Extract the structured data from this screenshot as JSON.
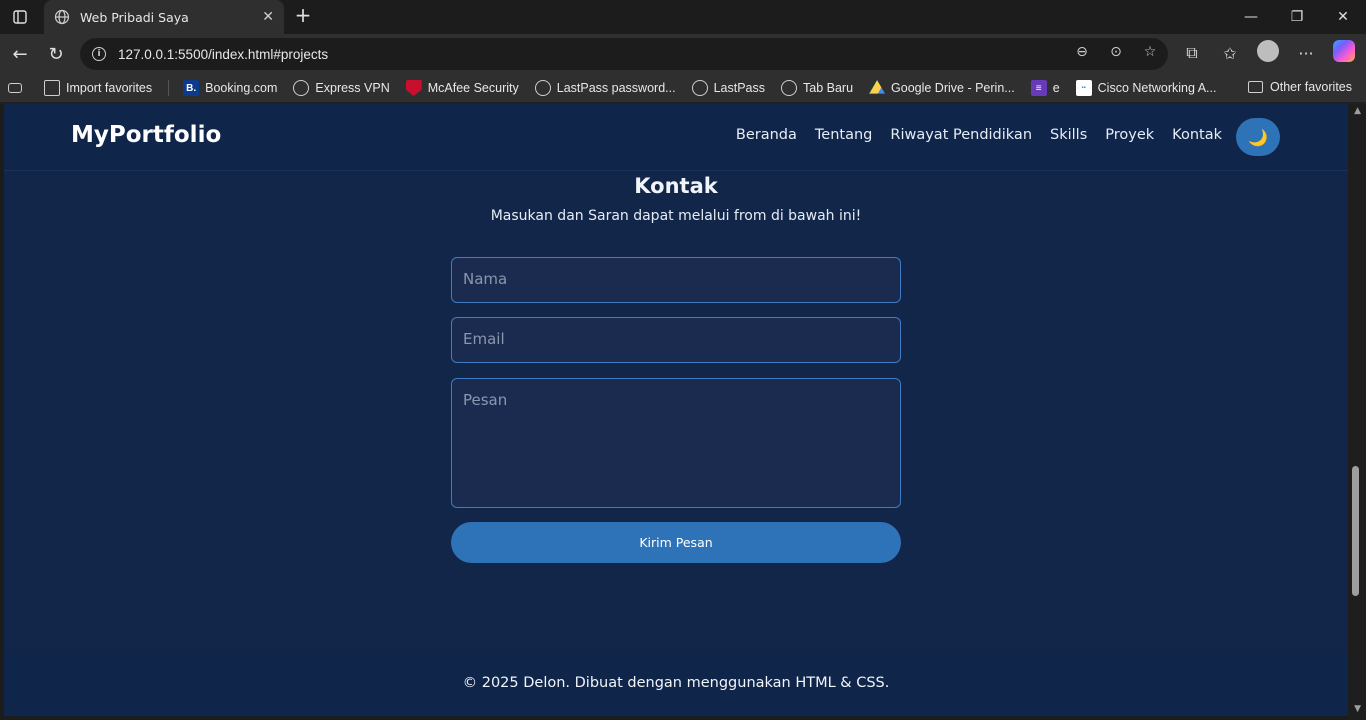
{
  "browser": {
    "tab_title": "Web Pribadi Saya",
    "url": "127.0.0.1:5500/index.html#projects",
    "favorites": [
      {
        "label": "Import favorites",
        "icon": "import-icon"
      },
      {
        "label": "Booking.com",
        "icon": "booking-icon"
      },
      {
        "label": "Express VPN",
        "icon": "globe-icon"
      },
      {
        "label": "McAfee Security",
        "icon": "mcafee-icon"
      },
      {
        "label": "LastPass password...",
        "icon": "globe-icon"
      },
      {
        "label": "LastPass",
        "icon": "globe-icon"
      },
      {
        "label": "Tab Baru",
        "icon": "globe-icon"
      },
      {
        "label": "Google Drive - Perin...",
        "icon": "google-drive-icon"
      },
      {
        "label": "e",
        "icon": "forms-icon"
      },
      {
        "label": "Cisco Networking A...",
        "icon": "cisco-icon"
      }
    ],
    "other_favorites": "Other favorites"
  },
  "site": {
    "logo": "MyPortfolio",
    "menu": [
      "Beranda",
      "Tentang",
      "Riwayat Pendidikan",
      "Skills",
      "Proyek",
      "Kontak"
    ],
    "theme_toggle_icon": "🌙"
  },
  "contact": {
    "title": "Kontak",
    "subtitle": "Masukan dan Saran dapat melalui from di bawah ini!",
    "name_placeholder": "Nama",
    "email_placeholder": "Email",
    "message_placeholder": "Pesan",
    "submit_label": "Kirim Pesan"
  },
  "footer": {
    "text": "© 2025 Delon. Dibuat dengan menggunakan HTML & CSS."
  },
  "colors": {
    "page_bg": "#12264a",
    "nav_bg": "#10254a",
    "accent": "#2e73b8",
    "field_border": "#3f7bc2"
  }
}
